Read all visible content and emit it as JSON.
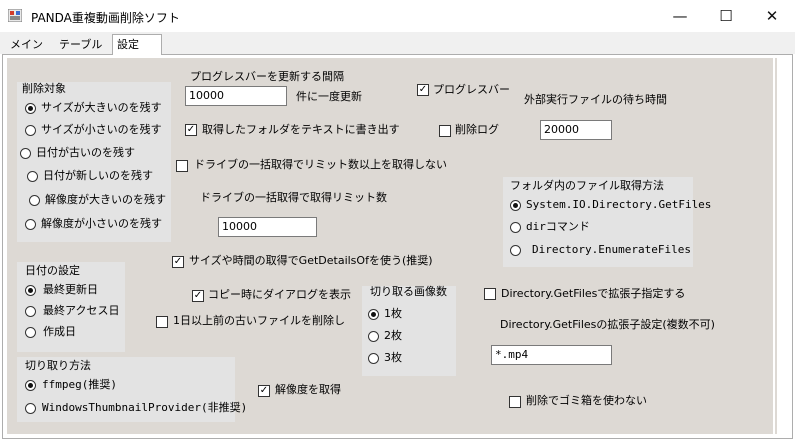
{
  "window": {
    "title": "PANDA重複動画削除ソフト",
    "minimize": "—",
    "maximize": "☐",
    "close": "✕"
  },
  "tabs": [
    {
      "label": "メイン",
      "selected": false
    },
    {
      "label": "テーブル",
      "selected": false
    },
    {
      "label": "設定",
      "selected": true
    }
  ],
  "delete_target": {
    "title": "削除対象",
    "options": [
      {
        "label": "サイズが大きいのを残す",
        "checked": true
      },
      {
        "label": "サイズが小さいのを残す",
        "checked": false
      },
      {
        "label": "日付が古いのを残す",
        "checked": false
      },
      {
        "label": "日付が新しいのを残す",
        "checked": false
      },
      {
        "label": "解像度が大きいのを残す",
        "checked": false
      },
      {
        "label": "解像度が小さいのを残す",
        "checked": false
      }
    ]
  },
  "date_setting": {
    "title": "日付の設定",
    "options": [
      {
        "label": "最終更新日",
        "checked": true
      },
      {
        "label": "最終アクセス日",
        "checked": false
      },
      {
        "label": "作成日",
        "checked": false
      }
    ]
  },
  "crop_method": {
    "title": "切り取り方法",
    "options": [
      {
        "label": "ffmpeg(推奨)",
        "checked": true
      },
      {
        "label": "WindowsThumbnailProvider(非推奨)",
        "checked": false
      }
    ]
  },
  "progress": {
    "label": "プログレスバーを更新する間隔",
    "value": "10000",
    "suffix": "件に一度更新",
    "checkbox_label": "プログレスバー",
    "checkbox_checked": true
  },
  "external_wait": {
    "label": "外部実行ファイルの待ち時間",
    "value": "20000"
  },
  "write_folders": {
    "label": "取得したフォルダをテキストに書き出す",
    "checked": true
  },
  "delete_log": {
    "label": "削除ログ",
    "checked": false
  },
  "drive_limit": {
    "checkbox_label": "ドライブの一括取得でリミット数以上を取得しない",
    "checkbox_checked": false,
    "label": "ドライブの一括取得で取得リミット数",
    "value": "10000"
  },
  "folder_method": {
    "title": "フォルダ内のファイル取得方法",
    "options": [
      {
        "label": "System.IO.Directory.GetFiles",
        "checked": true
      },
      {
        "label": "dirコマンド",
        "checked": false
      },
      {
        "label": "Directory.EnumerateFiles",
        "checked": false
      }
    ]
  },
  "use_details": {
    "label": "サイズや時間の取得でGetDetailsOfを使う(推奨)",
    "checked": true
  },
  "copy_dialog": {
    "label": "コピー時にダイアログを表示",
    "checked": true
  },
  "delete_old": {
    "label": "1日以上前の古いファイルを削除し",
    "checked": false
  },
  "crop_images": {
    "title": "切り取る画像数",
    "options": [
      {
        "label": "1枚",
        "checked": true
      },
      {
        "label": "2枚",
        "checked": false
      },
      {
        "label": "3枚",
        "checked": false
      }
    ]
  },
  "ext_specify": {
    "label": "Directory.GetFilesで拡張子指定する",
    "checked": false
  },
  "ext_setting": {
    "label": "Directory.GetFilesの拡張子設定(複数不可)",
    "value": "*.mp4"
  },
  "get_resolution": {
    "label": "解像度を取得",
    "checked": true
  },
  "no_recycle": {
    "label": "削除でゴミ箱を使わない",
    "checked": false
  }
}
